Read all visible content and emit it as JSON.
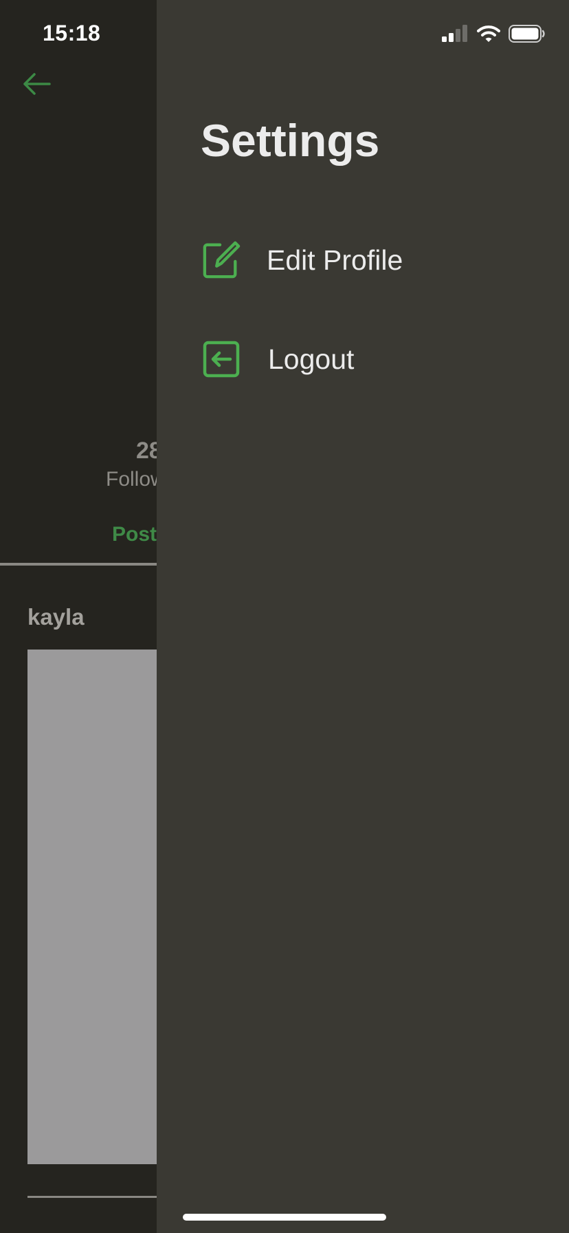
{
  "status_bar": {
    "time": "15:18"
  },
  "profile": {
    "back_icon": "arrow-left-icon",
    "followers_count": "28",
    "followers_label": "Follow",
    "tab_posts_label": "Post",
    "post": {
      "author": "kayla"
    }
  },
  "drawer": {
    "title": "Settings",
    "items": [
      {
        "label": "Edit Profile",
        "icon": "edit-square-icon"
      },
      {
        "label": "Logout",
        "icon": "logout-icon"
      }
    ]
  },
  "colors": {
    "accent": "#4caf50",
    "drawer_bg": "#3a3933",
    "screen_bg": "#25241f",
    "text": "#ececec"
  }
}
